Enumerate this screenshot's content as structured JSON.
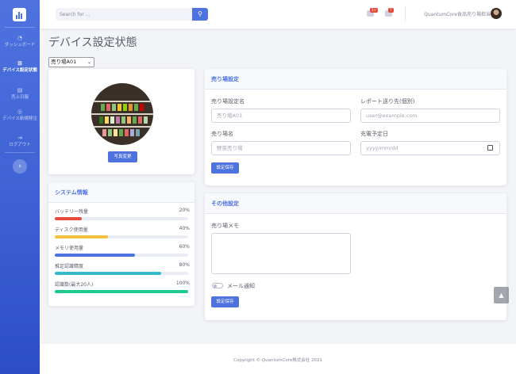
{
  "sidebar": {
    "brand_icon": "bar-chart-logo-icon",
    "items": [
      {
        "icon": "gauge-icon",
        "label": "ダッシュボード"
      },
      {
        "icon": "sitemap-icon",
        "label": "デバイス設定状態"
      },
      {
        "icon": "receipt-icon",
        "label": "売上日報"
      },
      {
        "icon": "broadcast-icon",
        "label": "デバイス新規発注"
      },
      {
        "icon": "logout-icon",
        "label": "ログアウト"
      }
    ],
    "toggle_glyph": "›"
  },
  "topbar": {
    "search_placeholder": "Search for ...",
    "search_icon": "🔍",
    "alerts_badge": "3+",
    "messages_badge": "7",
    "user_name": "QuantumCore食品売り場担当"
  },
  "page": {
    "title": "デバイス設定状態",
    "store_select": "売り場A01"
  },
  "photo_card": {
    "change_photo_button": "写真変更"
  },
  "system_info": {
    "header": "システム情報",
    "rows": [
      {
        "label": "バッテリー残量",
        "percent_label": "20%",
        "value": 20,
        "color": "#e74a3b"
      },
      {
        "label": "ディスク使用量",
        "percent_label": "40%",
        "value": 40,
        "color": "#f6c23e"
      },
      {
        "label": "メモリ使用量",
        "percent_label": "60%",
        "value": 60,
        "color": "#4e73df"
      },
      {
        "label": "推定認識精度",
        "percent_label": "80%",
        "value": 80,
        "color": "#36b9cc"
      },
      {
        "label": "認識数(最大20人)",
        "percent_label": "100%",
        "value": 100,
        "color": "#1cc88a"
      }
    ]
  },
  "store_settings": {
    "header": "売り場設定",
    "name_label": "売り場設定名",
    "name_placeholder": "売り場A01",
    "report_label": "レポート送り先(個別)",
    "report_placeholder": "user@example.com",
    "store_label": "売り場名",
    "store_placeholder": "野菜売り場",
    "charge_label": "充電予定日",
    "charge_placeholder": "yyyy/mm/dd",
    "save_button": "設定保存"
  },
  "other_settings": {
    "header": "その他設定",
    "memo_label": "売り場メモ",
    "mail_notification_label": "メール通知",
    "mail_notification_on": false,
    "save_button": "設定保存"
  },
  "footer": {
    "copyright": "Copyright © QuantumCore株式会社 2021"
  },
  "scroll_top_glyph": "▲",
  "colors": {
    "primary": "#4e73df",
    "sidebar_dark": "#2b4ec7",
    "danger": "#e74a3b"
  }
}
